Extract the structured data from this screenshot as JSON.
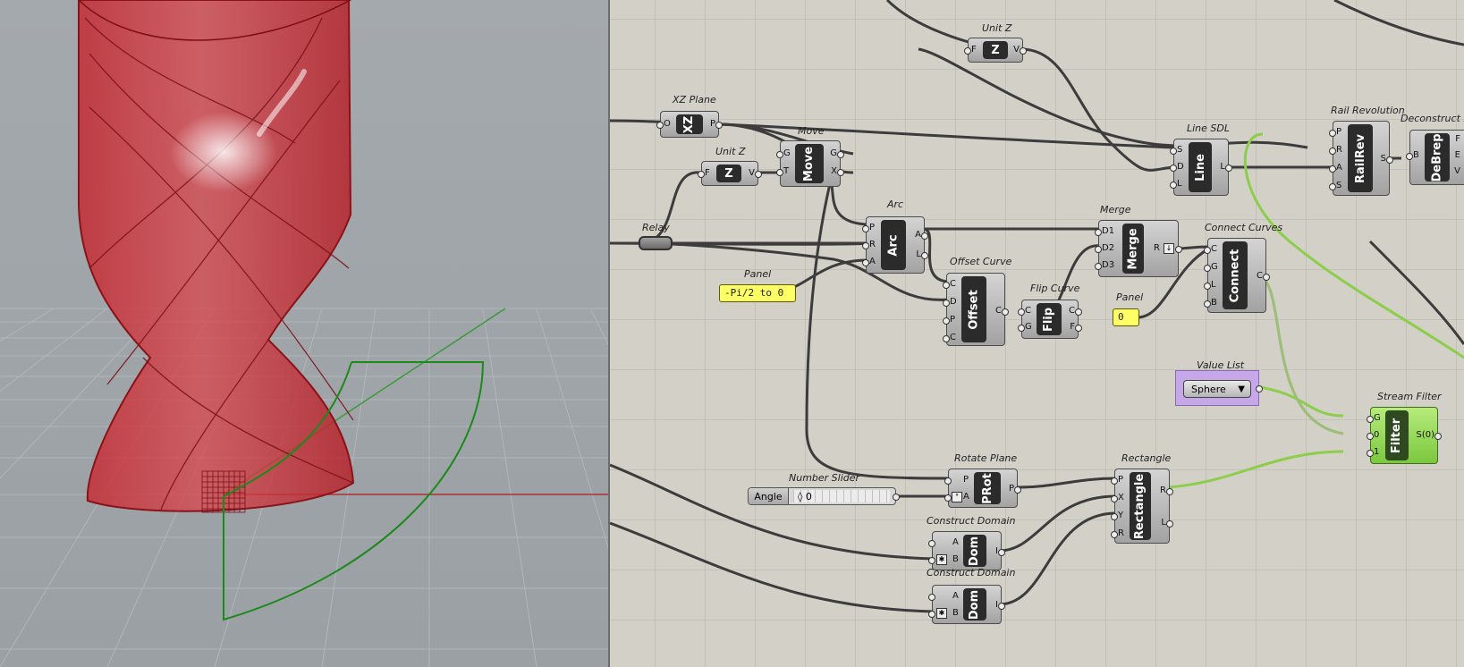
{
  "viewport": {
    "name": "rhino-perspective-viewport"
  },
  "canvas": {
    "name": "grasshopper-canvas"
  },
  "components": {
    "unit_z_top": {
      "title": "Unit Z",
      "label": "Z",
      "in": [
        "F"
      ],
      "out": [
        "V"
      ]
    },
    "xz_plane": {
      "title": "XZ Plane",
      "label": "XZ",
      "in": [
        "O"
      ],
      "out": [
        "P"
      ]
    },
    "unit_z": {
      "title": "Unit Z",
      "label": "Z",
      "in": [
        "F"
      ],
      "out": [
        "V"
      ]
    },
    "move": {
      "title": "Move",
      "label": "Move",
      "in": [
        "G",
        "T"
      ],
      "out": [
        "G",
        "X"
      ]
    },
    "relay": {
      "title": "Relay"
    },
    "arc": {
      "title": "Arc",
      "label": "Arc",
      "in": [
        "P",
        "R",
        "A"
      ],
      "out": [
        "A",
        "L"
      ]
    },
    "panel_pi": {
      "title": "Panel",
      "value": "-Pi/2 to 0"
    },
    "offset_curve": {
      "title": "Offset Curve",
      "label": "Offset",
      "in": [
        "C",
        "D",
        "P",
        "C"
      ],
      "out": [
        "C"
      ]
    },
    "flip_curve": {
      "title": "Flip Curve",
      "label": "Flip",
      "in": [
        "C",
        "G"
      ],
      "out": [
        "C",
        "F"
      ]
    },
    "merge": {
      "title": "Merge",
      "label": "Merge",
      "in": [
        "D1",
        "D2",
        "D3"
      ],
      "out": [
        "R"
      ]
    },
    "panel_zero": {
      "title": "Panel",
      "value": "0"
    },
    "connect_curves": {
      "title": "Connect Curves",
      "label": "Connect",
      "in": [
        "C",
        "G",
        "L",
        "B"
      ],
      "out": [
        "C"
      ]
    },
    "line_sdl": {
      "title": "Line SDL",
      "label": "Line",
      "in": [
        "S",
        "D",
        "L"
      ],
      "out": [
        "L"
      ]
    },
    "rail_revolution": {
      "title": "Rail Revolution",
      "label": "RailRev",
      "in": [
        "P",
        "R",
        "A",
        "S"
      ],
      "out": [
        "S"
      ]
    },
    "deconstruct_brep": {
      "title": "Deconstruct Br",
      "label": "DeBrep",
      "in": [
        "B"
      ],
      "out": [
        "F",
        "E",
        "V"
      ]
    },
    "value_list": {
      "title": "Value List",
      "value": "Sphere"
    },
    "stream_filter": {
      "title": "Stream Filter",
      "label": "Filter",
      "in": [
        "G",
        "0",
        "1"
      ],
      "out": [
        "S(0)"
      ]
    },
    "rotate_plane": {
      "title": "Rotate Plane",
      "label": "PRot",
      "in": [
        "P",
        "A"
      ],
      "out": [
        "P"
      ]
    },
    "number_slider": {
      "title": "Number Slider",
      "label": "Angle",
      "value": "◊ 0"
    },
    "rectangle": {
      "title": "Rectangle",
      "label": "Rectangle",
      "in": [
        "P",
        "X",
        "Y",
        "R"
      ],
      "out": [
        "R",
        "L"
      ]
    },
    "construct_domain_1": {
      "title": "Construct Domain",
      "label": "Dom",
      "in": [
        "A",
        "B"
      ],
      "out": [
        "I"
      ]
    },
    "construct_domain_2": {
      "title": "Construct Domain",
      "label": "Dom",
      "in": [
        "A",
        "B"
      ],
      "out": [
        "I"
      ]
    }
  },
  "colors": {
    "wire": "#3c3c3c",
    "wire_selected": "#8ccd4a",
    "shape": "#b3232b",
    "curve": "#1b8a1b",
    "axis_x": "#b03030",
    "axis_y": "#3a9a3a"
  }
}
